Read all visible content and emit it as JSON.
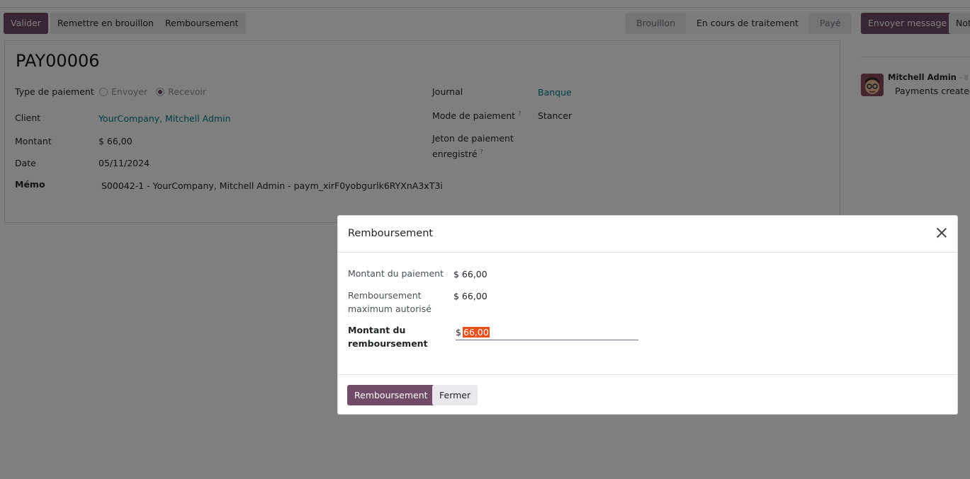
{
  "toolbar": {
    "validate_label": "Valider",
    "draft_label": "Remettre en brouillon",
    "refund_label": "Remboursement"
  },
  "statusbar": {
    "draft": "Brouillon",
    "processing": "En cours de traitement",
    "paid": "Payé"
  },
  "chatter": {
    "send_message_label": "Envoyer message",
    "note_label": "Not",
    "author": "Mitchell Admin",
    "time": "- il y a",
    "message": "Payments created"
  },
  "record": {
    "name": "PAY00006",
    "payment_type_label": "Type de paiement",
    "payment_type_send": "Envoyer",
    "payment_type_receive": "Recevoir",
    "client_label": "Client",
    "client_value": "YourCompany, Mitchell Admin",
    "amount_label": "Montant",
    "amount_value": "$ 66,00",
    "date_label": "Date",
    "date_value": "05/11/2024",
    "memo_label": "Mémo",
    "memo_value": "S00042-1 - YourCompany, Mitchell Admin - paym_xirF0yobgurlk6RYXnA3xT3i",
    "journal_label": "Journal",
    "journal_value": "Banque",
    "method_label": "Mode de paiement",
    "method_value": "Stancer",
    "token_label_line1": "Jeton de paiement",
    "token_label_line2": "enregistré",
    "help_mark": "?"
  },
  "dialog": {
    "title": "Remboursement",
    "payment_amount_label": "Montant du paiement",
    "payment_amount_value": "$ 66,00",
    "max_refund_label_line1": "Remboursement",
    "max_refund_label_line2": "maximum autorisé",
    "max_refund_value": "$ 66,00",
    "refund_amount_label_line1": "Montant du",
    "refund_amount_label_line2": "remboursement",
    "currency_symbol": "$",
    "refund_amount_value": "66,00",
    "confirm_label": "Remboursement",
    "close_label": "Fermer"
  },
  "colors": {
    "primary": "#714b67",
    "link": "#017e84",
    "selection": "#e8501c"
  }
}
